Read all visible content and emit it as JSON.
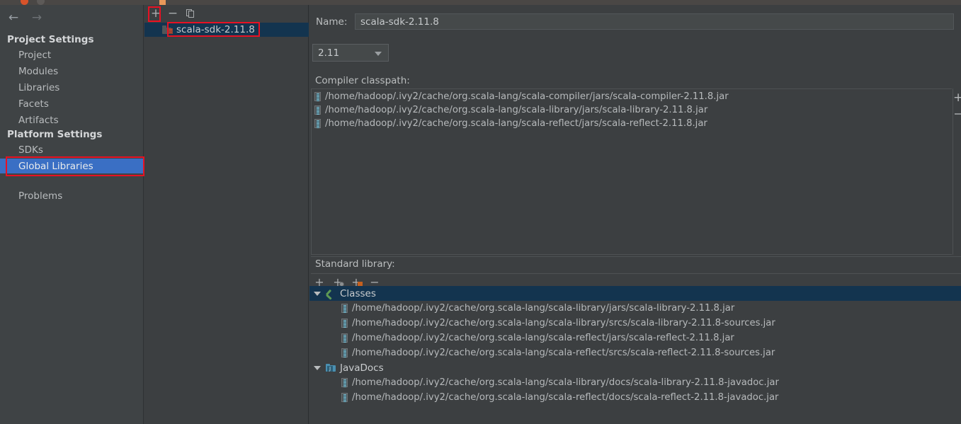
{
  "titlebar": {
    "close": "close-button",
    "minimize": "minimize-button"
  },
  "sidebar": {
    "back_icon": "←",
    "forward_icon": "→",
    "groups": [
      {
        "title": "Project Settings",
        "items": [
          {
            "label": "Project",
            "selected": false
          },
          {
            "label": "Modules",
            "selected": false
          },
          {
            "label": "Libraries",
            "selected": false
          },
          {
            "label": "Facets",
            "selected": false
          },
          {
            "label": "Artifacts",
            "selected": false
          }
        ]
      },
      {
        "title": "Platform Settings",
        "items": [
          {
            "label": "SDKs",
            "selected": false
          },
          {
            "label": "Global Libraries",
            "selected": true
          }
        ]
      }
    ],
    "problems": {
      "label": "Problems",
      "selected": false
    }
  },
  "library_panel": {
    "toolbar": {
      "add": "+",
      "remove": "−",
      "copy": "copy-icon"
    },
    "items": [
      {
        "label": "scala-sdk-2.11.8",
        "selected": true
      }
    ]
  },
  "detail": {
    "name_label": "Name:",
    "name_value": "scala-sdk-2.11.8",
    "name_placeholder": "",
    "version_value": "2.11",
    "version_options": [
      "2.11"
    ],
    "compiler_classpath_label": "Compiler classpath:",
    "compiler_classpath": [
      "/home/hadoop/.ivy2/cache/org.scala-lang/scala-compiler/jars/scala-compiler-2.11.8.jar",
      "/home/hadoop/.ivy2/cache/org.scala-lang/scala-library/jars/scala-library-2.11.8.jar",
      "/home/hadoop/.ivy2/cache/org.scala-lang/scala-reflect/jars/scala-reflect-2.11.8.jar"
    ],
    "classpath_buttons": {
      "add": "+",
      "remove": "−"
    },
    "standard_library_label": "Standard library:",
    "standard_library_toolbar": {
      "add": "+",
      "add_sources": "+",
      "add_javadocs": "+",
      "remove": "−"
    },
    "tree": [
      {
        "label": "Classes",
        "icon": "classes-icon",
        "selected": true,
        "expanded": true,
        "children": [
          "/home/hadoop/.ivy2/cache/org.scala-lang/scala-library/jars/scala-library-2.11.8.jar",
          "/home/hadoop/.ivy2/cache/org.scala-lang/scala-library/srcs/scala-library-2.11.8-sources.jar",
          "/home/hadoop/.ivy2/cache/org.scala-lang/scala-reflect/jars/scala-reflect-2.11.8.jar",
          "/home/hadoop/.ivy2/cache/org.scala-lang/scala-reflect/srcs/scala-reflect-2.11.8-sources.jar"
        ]
      },
      {
        "label": "JavaDocs",
        "icon": "javadocs-folder-icon",
        "selected": false,
        "expanded": true,
        "children": [
          "/home/hadoop/.ivy2/cache/org.scala-lang/scala-library/docs/scala-library-2.11.8-javadoc.jar",
          "/home/hadoop/.ivy2/cache/org.scala-lang/scala-reflect/docs/scala-reflect-2.11.8-javadoc.jar"
        ]
      }
    ]
  },
  "colors": {
    "background": "#3c3f41",
    "sidebar_background": "#3f4345",
    "selection_blue": "#3a6fc4",
    "tree_selection": "#13344f",
    "annotation_red": "#e81123",
    "text": "#b9bcbe"
  }
}
